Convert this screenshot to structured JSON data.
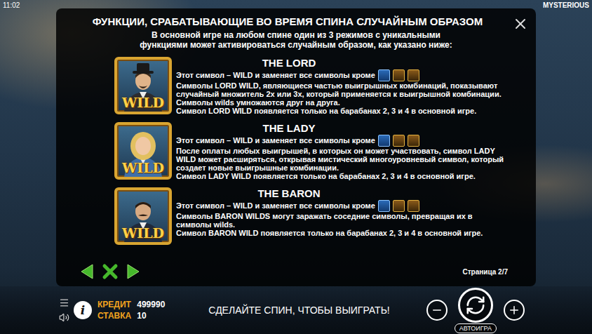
{
  "status": {
    "time": "11:02",
    "game": "MYSTERIOUS"
  },
  "panel": {
    "title": "ФУНКЦИИ, СРАБАТЫВАЮЩИЕ ВО ВРЕМЯ СПИНА СЛУЧАЙНЫМ ОБРАЗОМ",
    "intro": "В основной игре на любом спине один из 3 режимов с уникальными функциями может активироваться случайным образом, как указано ниже:",
    "sections": [
      {
        "name": "THE LORD",
        "kind": "lord",
        "symbol_label": "WILD",
        "substitute_text": "Этот символ – WILD и заменяет все символы кроме",
        "lines": [
          "Символы LORD WILD, являющиеся частью выигрышных комбинаций, показывают случайный множитель 2x или 3x, который применяется к выигрышной комбинации.",
          "Символы wilds умножаются друг на друга.",
          "Символ LORD WILD появляется только на барабанах 2, 3 и 4 в основной игре."
        ]
      },
      {
        "name": "THE LADY",
        "kind": "lady",
        "symbol_label": "WILD",
        "substitute_text": "Этот символ – WILD и заменяет все символы кроме",
        "lines": [
          "После оплаты любых выигрышей, в которых он может участвовать, символ LADY WILD может расширяться, открывая мистический многоуровневый символ, который создает новые выигрышные комбинации.",
          "Символ LADY WILD появляется только на барабанах 2, 3 и 4 в основной игре."
        ]
      },
      {
        "name": "THE BARON",
        "kind": "baron",
        "symbol_label": "WILD",
        "substitute_text": "Этот символ – WILD и заменяет все символы кроме",
        "lines": [
          "Символы BARON WILDS могут заражать соседние символы, превращая их в символы wilds.",
          "Символ BARON WILD появляется только на барабанах 2, 3 и 4 в основной игре."
        ]
      }
    ],
    "page": "Страница 2/7"
  },
  "bottom_bar": {
    "info": "i",
    "credit_label": "КРЕДИТ",
    "credit_value": "499990",
    "bet_label": "СТАВКА",
    "bet_value": "10",
    "message": "СДЕЛАЙТЕ СПИН, ЧТОБЫ ВЫИГРАТЬ!",
    "autoplay": "АВТОИГРА"
  }
}
